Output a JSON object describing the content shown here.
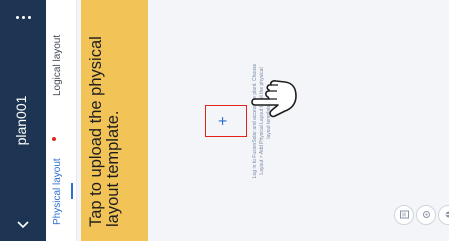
{
  "header": {
    "title": "plan001",
    "back_icon": "chevron-left-icon",
    "more_icon": "more-vertical-icon"
  },
  "tabs": [
    {
      "label": "Physical layout",
      "active": true,
      "has_alert_dot": true
    },
    {
      "label": "Logical layout",
      "active": false
    }
  ],
  "toolbar": {
    "icons": [
      "layout-icon",
      "locate-icon",
      "layers-icon",
      "expand-icon"
    ]
  },
  "upload": {
    "plus_symbol": "+",
    "hint": "Log in to FusionSolar and access the plant. Choose Layout > Add Physical Layout to set the physical layout template."
  },
  "tooltip": {
    "text": "Tap to upload the physical layout template."
  },
  "colors": {
    "header_bg": "#1d3553",
    "accent": "#2f6fd1",
    "highlight": "#e2231a",
    "tooltip_bg": "#f2c356"
  }
}
